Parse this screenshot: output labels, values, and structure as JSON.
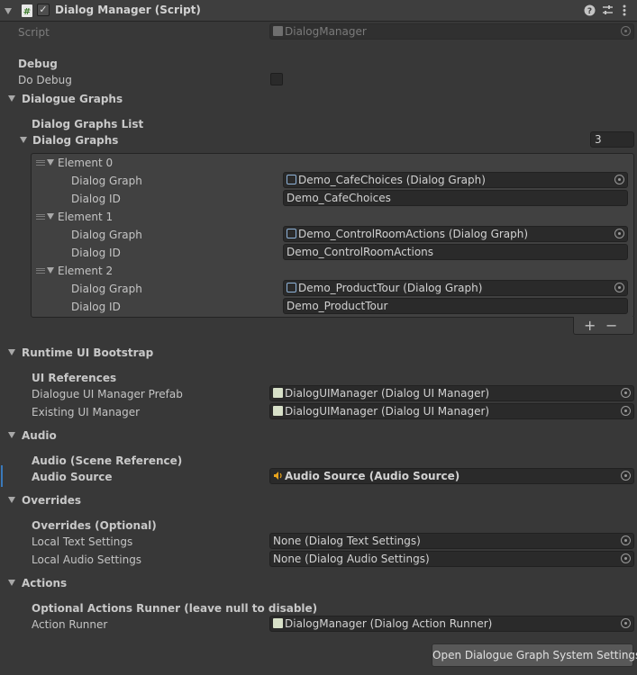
{
  "component": {
    "title": "Dialog Manager (Script)",
    "enabled": true,
    "script_label": "Script",
    "script_value": "DialogManager"
  },
  "debug": {
    "header": "Debug",
    "do_debug_label": "Do Debug",
    "do_debug": false
  },
  "dialogue_graphs": {
    "header": "Dialogue Graphs",
    "list_header": "Dialog Graphs List",
    "list_label": "Dialog Graphs",
    "count": "3",
    "graph_label": "Dialog Graph",
    "id_label": "Dialog ID",
    "elements": [
      {
        "label": "Element 0",
        "graph": "Demo_CafeChoices (Dialog Graph)",
        "id": "Demo_CafeChoices"
      },
      {
        "label": "Element 1",
        "graph": "Demo_ControlRoomActions (Dialog Graph)",
        "id": "Demo_ControlRoomActions"
      },
      {
        "label": "Element 2",
        "graph": "Demo_ProductTour (Dialog Graph)",
        "id": "Demo_ProductTour"
      }
    ],
    "add_label": "+",
    "remove_label": "−"
  },
  "runtime_ui": {
    "header": "Runtime UI Bootstrap",
    "sub_header": "UI References",
    "prefab_label": "Dialogue UI Manager Prefab",
    "prefab_value": "DialogUIManager (Dialog UI Manager)",
    "existing_label": "Existing UI Manager",
    "existing_value": "DialogUIManager (Dialog UI Manager)"
  },
  "audio": {
    "header": "Audio",
    "sub_header": "Audio (Scene Reference)",
    "source_label": "Audio Source",
    "source_value": "Audio Source (Audio Source)"
  },
  "overrides": {
    "header": "Overrides",
    "sub_header": "Overrides (Optional)",
    "text_label": "Local Text Settings",
    "text_value": "None (Dialog Text Settings)",
    "audio_label": "Local Audio Settings",
    "audio_value": "None (Dialog Audio Settings)"
  },
  "actions": {
    "header": "Actions",
    "sub_header": "Optional Actions Runner (leave null to disable)",
    "runner_label": "Action Runner",
    "runner_value": "DialogManager (Dialog Action Runner)"
  },
  "settings_button": "Open Dialogue Graph System Settings",
  "colors": {
    "background": "#383838",
    "field": "#2a2a2a",
    "accent": "#3a79bb",
    "audio_icon": "#e8a31c",
    "script_icon": "#8fc160"
  }
}
